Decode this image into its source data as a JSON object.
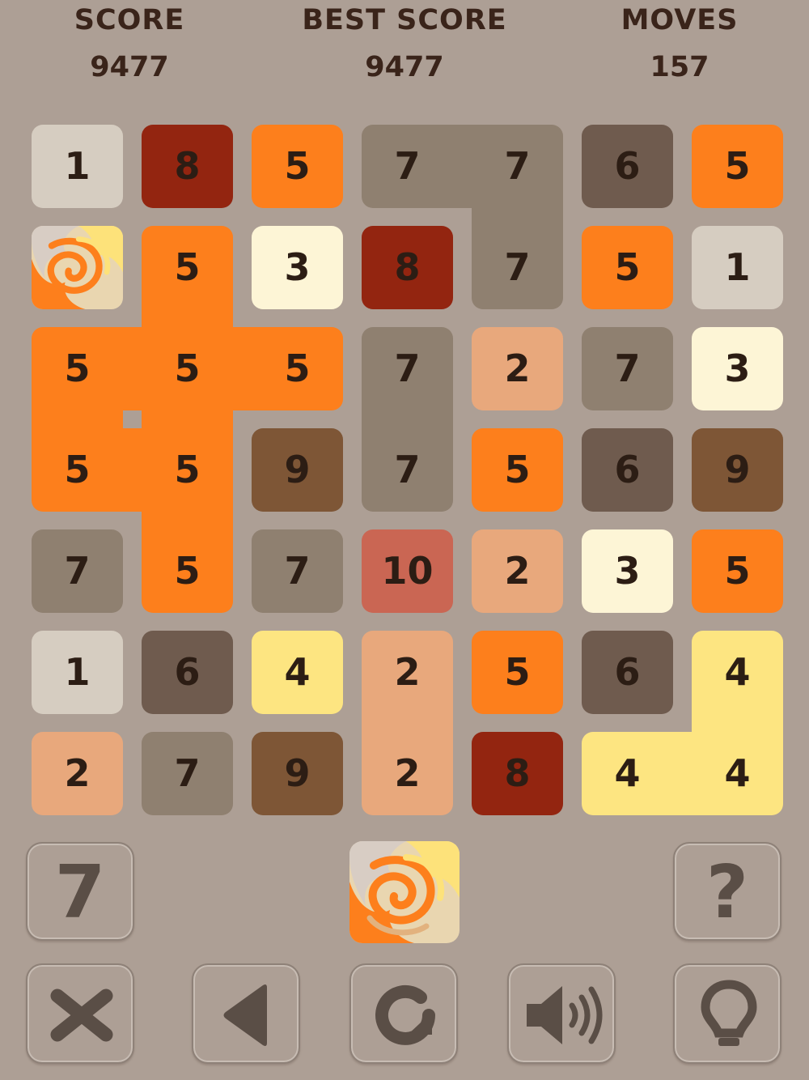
{
  "stats": {
    "score_label": "SCORE",
    "score_value": "9477",
    "best_label": "BEST SCORE",
    "best_value": "9477",
    "moves_label": "MOVES",
    "moves_value": "157"
  },
  "colors": {
    "1": "#d6cdc1",
    "2": "#e8a87c",
    "3": "#fdf5d6",
    "4": "#fde581",
    "5": "#fd7f1c",
    "6": "#6f5b4e",
    "7": "#8f8070",
    "8": "#932510",
    "9": "#7e5636",
    "10": "#ca6653",
    "background": "#ad9f95",
    "text": "#2c1d14"
  },
  "board": {
    "rows": 7,
    "cols": 7,
    "cells": [
      [
        "1",
        "8",
        "5",
        "7",
        "7",
        "6",
        "5"
      ],
      [
        "swirl",
        "5",
        "3",
        "8",
        "7",
        "5",
        "1"
      ],
      [
        "5",
        "5",
        "5",
        "7",
        "2",
        "7",
        "3"
      ],
      [
        "5",
        "5",
        "9",
        "7",
        "5",
        "6",
        "9"
      ],
      [
        "7",
        "5",
        "7",
        "10",
        "2",
        "3",
        "5"
      ],
      [
        "1",
        "6",
        "4",
        "2",
        "5",
        "6",
        "4"
      ],
      [
        "2",
        "7",
        "9",
        "2",
        "8",
        "4",
        "4"
      ]
    ],
    "special_icon": "swirl-bomb-icon"
  },
  "controls": {
    "next_tile": "7",
    "help_label": "?",
    "current_piece_icon": "swirl-bomb-icon",
    "buttons": [
      "close-icon",
      "back-icon",
      "restart-icon",
      "sound-icon",
      "hint-bulb-icon"
    ]
  }
}
